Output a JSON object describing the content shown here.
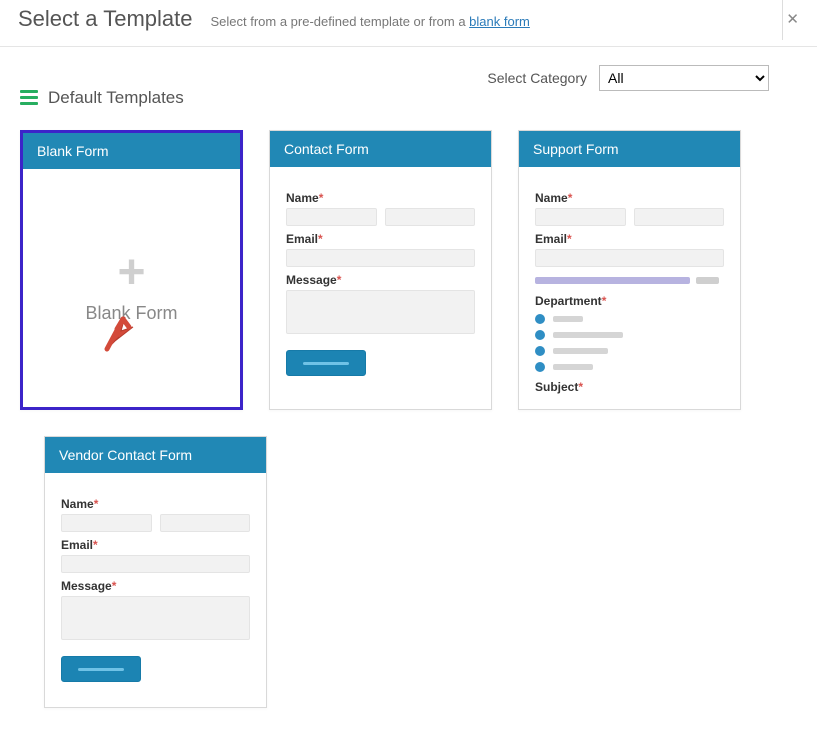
{
  "header": {
    "title": "Select a Template",
    "desc_prefix": "Select from a pre-defined template or from a ",
    "blank_link_text": "blank form"
  },
  "category": {
    "label": "Select Category",
    "selected": "All",
    "options": [
      "All"
    ]
  },
  "section": {
    "title": "Default Templates"
  },
  "cards": {
    "blank": {
      "title": "Blank Form",
      "body_label": "Blank Form"
    },
    "contact": {
      "title": "Contact Form",
      "name_label": "Name",
      "email_label": "Email",
      "message_label": "Message"
    },
    "support": {
      "title": "Support Form",
      "name_label": "Name",
      "email_label": "Email",
      "department_label": "Department",
      "subject_label": "Subject"
    },
    "vendor": {
      "title": "Vendor Contact Form",
      "name_label": "Name",
      "email_label": "Email",
      "message_label": "Message"
    }
  },
  "required_marker": "*"
}
